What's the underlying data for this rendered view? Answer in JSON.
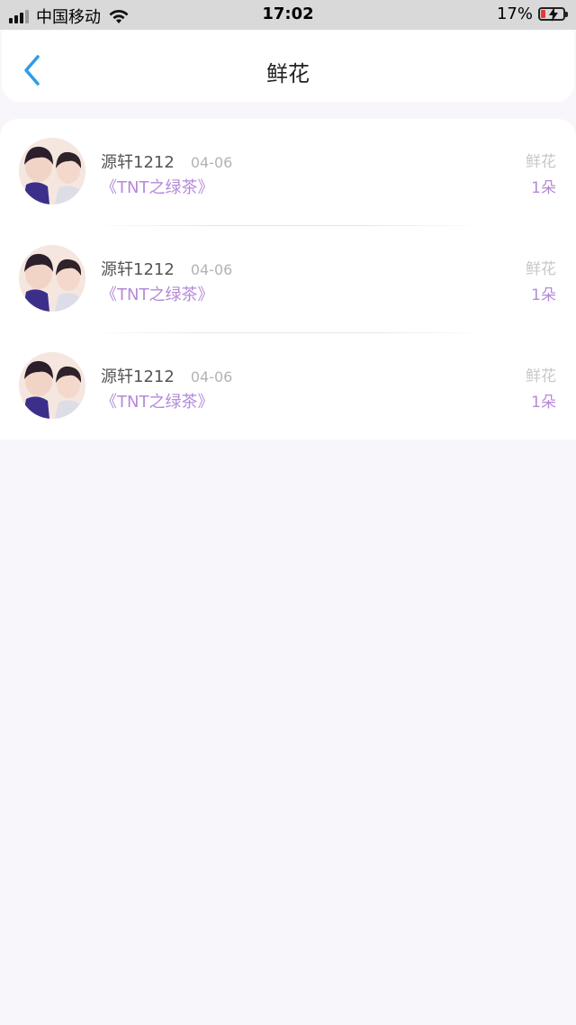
{
  "status_bar": {
    "carrier": "中国移动",
    "time": "17:02",
    "battery_percent": "17%"
  },
  "nav": {
    "title": "鲜花"
  },
  "items": [
    {
      "username": "源轩1212",
      "date": "04-06",
      "gift_name": "《TNT之绿茶》",
      "gift_type": "鲜花",
      "gift_count": "1朵"
    },
    {
      "username": "源轩1212",
      "date": "04-06",
      "gift_name": "《TNT之绿茶》",
      "gift_type": "鲜花",
      "gift_count": "1朵"
    },
    {
      "username": "源轩1212",
      "date": "04-06",
      "gift_name": "《TNT之绿茶》",
      "gift_type": "鲜花",
      "gift_count": "1朵"
    }
  ],
  "colors": {
    "accent_blue": "#2f9be8",
    "gift_purple": "#b48ad8",
    "background": "#f8f6fa"
  }
}
